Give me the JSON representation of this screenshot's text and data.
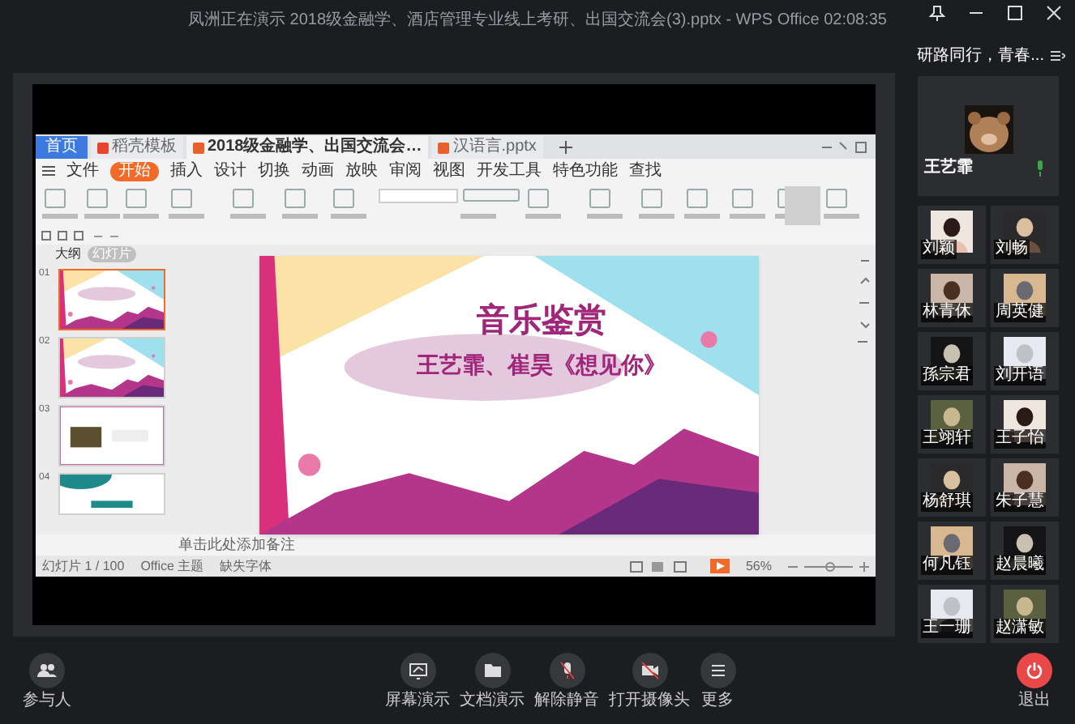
{
  "title_bar": {
    "title": "凤洲正在演示 2018级金融学、酒店管理专业线上考研、出国交流会(3).pptx - WPS Office 02:08:35"
  },
  "meeting_name": "研路同行，青春...",
  "wps": {
    "tabs": [
      {
        "label": "首页",
        "kind": "home",
        "selected": false
      },
      {
        "label": "稻壳模板",
        "kind": "doc",
        "selected": false
      },
      {
        "label": "2018级金融学、出国交流会…",
        "kind": "doc",
        "selected": true
      },
      {
        "label": "汉语言.pptx",
        "kind": "doc",
        "selected": false
      }
    ],
    "menu": [
      {
        "label": "文件",
        "selected": false
      },
      {
        "label": "开始",
        "selected": true
      },
      {
        "label": "插入",
        "selected": false
      },
      {
        "label": "设计",
        "selected": false
      },
      {
        "label": "切换",
        "selected": false
      },
      {
        "label": "动画",
        "selected": false
      },
      {
        "label": "放映",
        "selected": false
      },
      {
        "label": "审阅",
        "selected": false
      },
      {
        "label": "视图",
        "selected": false
      },
      {
        "label": "开发工具",
        "selected": false
      },
      {
        "label": "特色功能",
        "selected": false
      },
      {
        "label": "查找",
        "selected": false
      }
    ],
    "panel_tabs": [
      {
        "label": "大纲",
        "selected": false
      },
      {
        "label": "幻灯片",
        "selected": true
      }
    ],
    "thumbnails": [
      {
        "number": "01",
        "selected": true
      },
      {
        "number": "02",
        "selected": false
      },
      {
        "number": "03",
        "selected": false
      },
      {
        "number": "04",
        "selected": false
      }
    ],
    "slide": {
      "title": "音乐鉴赏",
      "subtitle": "王艺霏、崔昊《想见你》"
    },
    "notes_placeholder": "单击此处添加备注",
    "status": [
      "幻灯片 1 / 100",
      "Office 主题",
      "缺失字体"
    ],
    "zoom": "56%"
  },
  "speaker": {
    "name": "王艺霏",
    "mic_on": true
  },
  "participants": [
    {
      "name": "刘颖"
    },
    {
      "name": "刘畅"
    },
    {
      "name": "林青休"
    },
    {
      "name": "周英健"
    },
    {
      "name": "孫宗君"
    },
    {
      "name": "刘开语"
    },
    {
      "name": "王翊轩"
    },
    {
      "name": "王子怡"
    },
    {
      "name": "杨舒琪"
    },
    {
      "name": "朱子慧"
    },
    {
      "name": "何凡钰"
    },
    {
      "name": "赵晨曦"
    },
    {
      "name": "王一珊"
    },
    {
      "name": "赵潇敏"
    }
  ],
  "participants_button": {
    "label": "参与人"
  },
  "controls": [
    {
      "label": "屏幕演示",
      "kind": "screen"
    },
    {
      "label": "文档演示",
      "kind": "folder"
    },
    {
      "label": "解除静音",
      "kind": "mic_off"
    },
    {
      "label": "打开摄像头",
      "kind": "camera_off"
    },
    {
      "label": "更多",
      "kind": "more"
    }
  ],
  "leave": {
    "label": "退出"
  }
}
